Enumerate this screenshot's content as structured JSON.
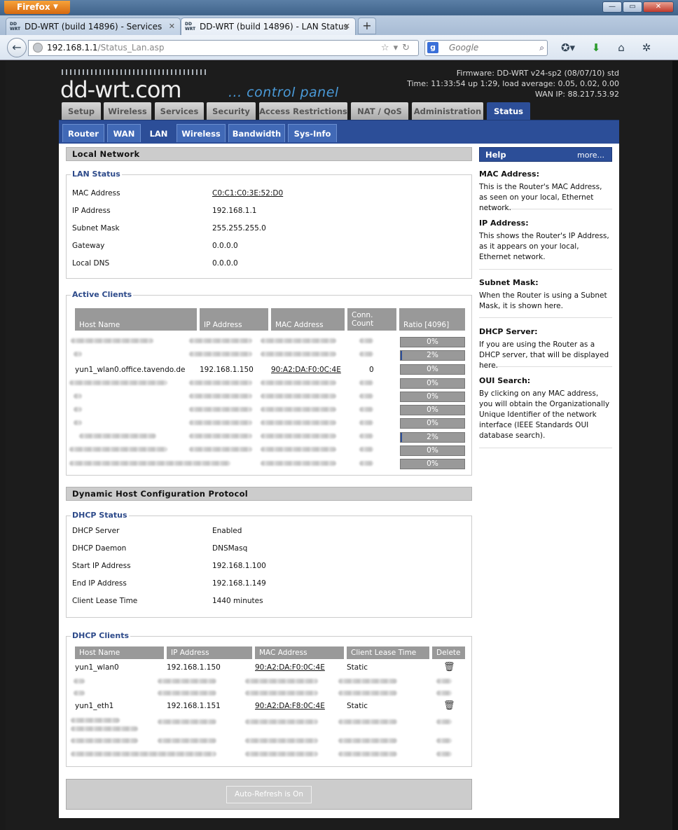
{
  "browser": {
    "menu_label": "Firefox",
    "window_buttons": [
      "—",
      "▭",
      "✕"
    ],
    "tabs": [
      {
        "label": "DD-WRT (build 14896) - Services"
      },
      {
        "label": "DD-WRT (build 14896) - LAN Status"
      }
    ],
    "url_host": "192.168.1.1",
    "url_path": "/Status_Lan.asp",
    "search_placeholder": "Google",
    "search_engine_letter": "g"
  },
  "header": {
    "logo": "dd-wrt.com",
    "subtitle": "... control panel",
    "firmware": "Firmware: DD-WRT v24-sp2 (08/07/10) std",
    "time": "Time: 11:33:54 up 1:29, load average: 0.05, 0.02, 0.00",
    "wan_ip": "WAN IP: 88.217.53.92"
  },
  "main_tabs": [
    "Setup",
    "Wireless",
    "Services",
    "Security",
    "Access Restrictions",
    "NAT / QoS",
    "Administration",
    "Status"
  ],
  "sub_tabs": [
    "Router",
    "WAN",
    "LAN",
    "Wireless",
    "Bandwidth",
    "Sys-Info"
  ],
  "local_network": {
    "title": "Local Network",
    "lan_status_legend": "LAN Status",
    "rows": [
      {
        "label": "MAC Address",
        "value": "C0:C1:C0:3E:52:D0"
      },
      {
        "label": "IP Address",
        "value": "192.168.1.1"
      },
      {
        "label": "Subnet Mask",
        "value": "255.255.255.0"
      },
      {
        "label": "Gateway",
        "value": "0.0.0.0"
      },
      {
        "label": "Local DNS",
        "value": "0.0.0.0"
      }
    ]
  },
  "active_clients": {
    "legend": "Active Clients",
    "headers": [
      "Host Name",
      "IP Address",
      "MAC Address",
      "Conn. Count",
      "Ratio [4096]"
    ],
    "visible_client": {
      "host": "yun1_wlan0.office.tavendo.de",
      "ip": "192.168.1.150",
      "mac": "90:A2:DA:F0:0C:4E",
      "conn": "0"
    },
    "ratios": [
      "0%",
      "2%",
      "0%",
      "0%",
      "0%",
      "0%",
      "0%",
      "2%",
      "0%",
      "0%"
    ],
    "ratio_values": [
      0,
      2,
      0,
      0,
      0,
      0,
      0,
      2,
      0,
      0
    ]
  },
  "dhcp": {
    "title": "Dynamic Host Configuration Protocol",
    "status_legend": "DHCP Status",
    "rows": [
      {
        "label": "DHCP Server",
        "value": "Enabled"
      },
      {
        "label": "DHCP Daemon",
        "value": "DNSMasq"
      },
      {
        "label": "Start IP Address",
        "value": "192.168.1.100"
      },
      {
        "label": "End IP Address",
        "value": "192.168.1.149"
      },
      {
        "label": "Client Lease Time",
        "value": "1440 minutes"
      }
    ],
    "clients_legend": "DHCP Clients",
    "client_headers": [
      "Host Name",
      "IP Address",
      "MAC Address",
      "Client Lease Time",
      "Delete"
    ],
    "clients": [
      {
        "host": "yun1_wlan0",
        "ip": "192.168.1.150",
        "mac": "90:A2:DA:F0:0C:4E",
        "lease": "Static"
      },
      {
        "host": "yun1_eth1",
        "ip": "192.168.1.151",
        "mac": "90:A2:DA:F8:0C:4E",
        "lease": "Static"
      }
    ]
  },
  "help": {
    "title": "Help",
    "more": "more...",
    "items": [
      {
        "title": "MAC Address:",
        "text": "This is the Router's MAC Address, as seen on your local, Ethernet network."
      },
      {
        "title": "IP Address:",
        "text": "This shows the Router's IP Address, as it appears on your local, Ethernet network."
      },
      {
        "title": "Subnet Mask:",
        "text": "When the Router is using a Subnet Mask, it is shown here."
      },
      {
        "title": "DHCP Server:",
        "text": "If you are using the Router as a DHCP server, that will be displayed here."
      },
      {
        "title": "OUI Search:",
        "text": "By clicking on any MAC address, you will obtain the Organizationally Unique Identifier of the network interface (IEEE Standards OUI database search)."
      }
    ]
  },
  "refresh_label": "Auto-Refresh is On"
}
